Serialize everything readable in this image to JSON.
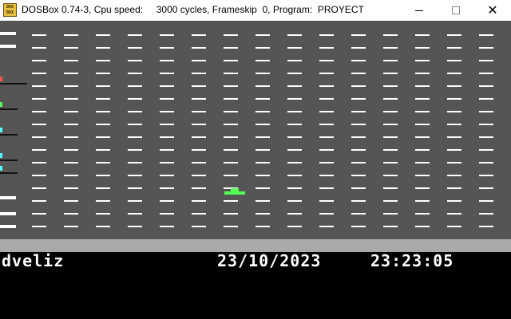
{
  "window": {
    "title": "DOSBox 0.74-3, Cpu speed:     3000 cycles, Frameskip  0, Program:  PROYECT",
    "icon_top": "DOS",
    "icon_bottom": "BOX",
    "minimize_icon": "minimize-icon",
    "maximize_icon": "maximize-icon",
    "close_glyph": "✕"
  },
  "game": {
    "road_color": "#555555",
    "lane_mark_color": "#ffffff",
    "player_color": "#55ff55",
    "divider_color": "#aaaaaa",
    "side_dot_colors": [
      "#ff5555",
      "#55ff55",
      "#55ffff",
      "#55ffff",
      "#55ffff"
    ]
  },
  "status": {
    "user": "dveliz",
    "date": "23/10/2023",
    "time": "23:23:05"
  }
}
